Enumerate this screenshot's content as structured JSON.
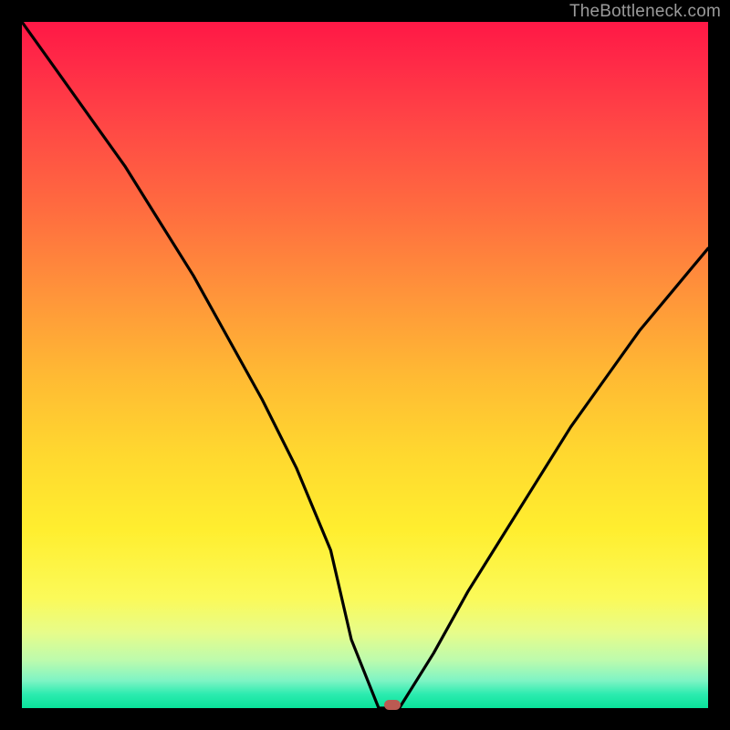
{
  "branding": {
    "text": "TheBottleneck.com"
  },
  "colors": {
    "frame": "#000000",
    "marker": "#bb5a52",
    "curve": "#000000",
    "gradient_top": "#ff1846",
    "gradient_bottom": "#09e29a"
  },
  "chart_data": {
    "type": "line",
    "title": "",
    "xlabel": "",
    "ylabel": "",
    "xlim": [
      0,
      100
    ],
    "ylim": [
      0,
      100
    ],
    "x": [
      0,
      5,
      10,
      15,
      20,
      25,
      30,
      35,
      40,
      45,
      48,
      52,
      55,
      60,
      65,
      70,
      75,
      80,
      85,
      90,
      95,
      100
    ],
    "values": [
      100,
      93,
      86,
      79,
      71,
      63,
      54,
      45,
      35,
      23,
      10,
      0,
      0,
      8,
      17,
      25,
      33,
      41,
      48,
      55,
      61,
      67
    ],
    "marker": {
      "x": 54,
      "y": 0
    },
    "grid": false,
    "legend": false
  }
}
